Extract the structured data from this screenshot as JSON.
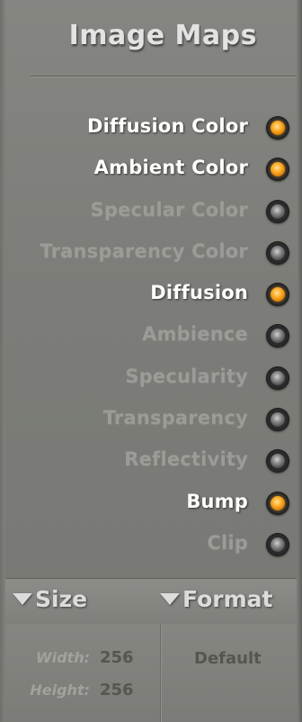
{
  "panel": {
    "title": "Image Maps"
  },
  "maps": [
    {
      "label": "Diffusion Color",
      "enabled": true
    },
    {
      "label": "Ambient Color",
      "enabled": true
    },
    {
      "label": "Specular Color",
      "enabled": false
    },
    {
      "label": "Transparency Color",
      "enabled": false
    },
    {
      "label": "Diffusion",
      "enabled": true
    },
    {
      "label": "Ambience",
      "enabled": false
    },
    {
      "label": "Specularity",
      "enabled": false
    },
    {
      "label": "Transparency",
      "enabled": false
    },
    {
      "label": "Reflectivity",
      "enabled": false
    },
    {
      "label": "Bump",
      "enabled": true
    },
    {
      "label": "Clip",
      "enabled": false
    }
  ],
  "size": {
    "label": "Size",
    "width_label": "Width:",
    "width_value": "256",
    "height_label": "Height:",
    "height_value": "256"
  },
  "format": {
    "label": "Format",
    "value": "Default"
  },
  "colors": {
    "led_on": "#f5a623",
    "led_off": "#3a3a3a",
    "label_on": "#ffffff",
    "label_off": "#9b9c97",
    "panel_bg": "#7f807b"
  }
}
